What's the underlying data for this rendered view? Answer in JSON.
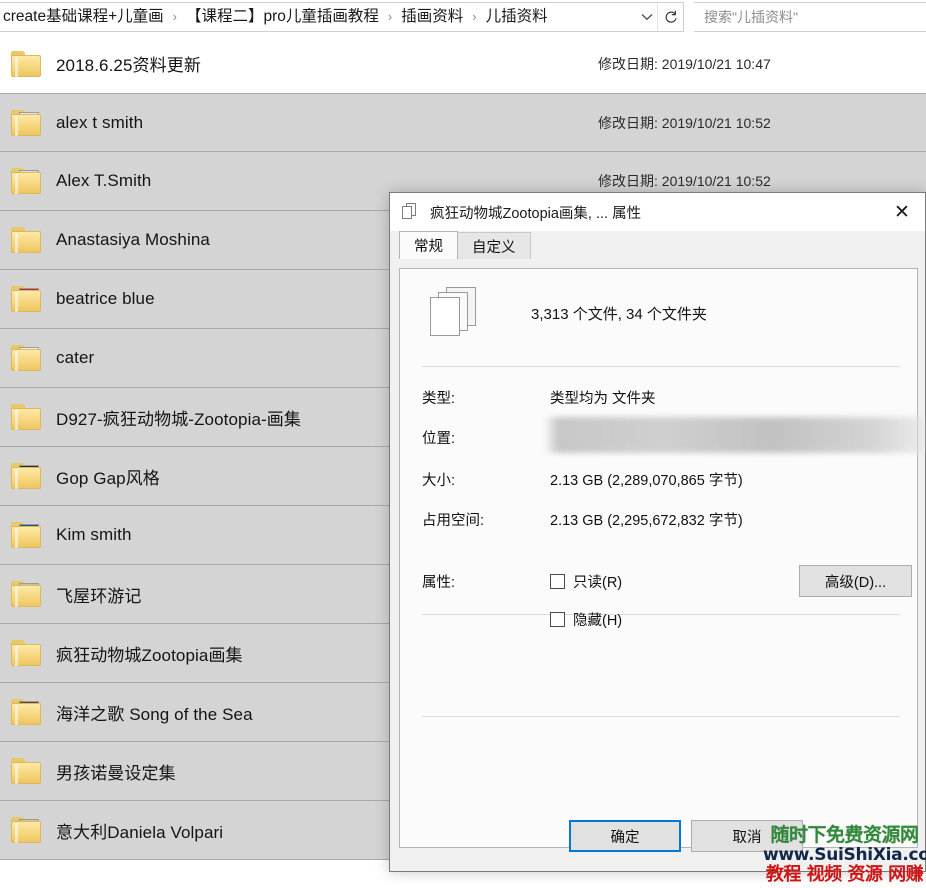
{
  "addressbar": {
    "breadcrumbs": [
      "create基础课程+儿童画",
      "【课程二】pro儿童插画教程",
      "插画资料",
      "儿插资料"
    ],
    "separator": "›",
    "dropdown_icon": "chevron-down-icon",
    "refresh_icon": "refresh-icon",
    "refresh_glyph": "↻"
  },
  "search": {
    "placeholder": "搜索\"儿插资料\""
  },
  "filelist": {
    "date_label": "修改日期:",
    "rows": [
      {
        "name": "2018.6.25资料更新",
        "date": "修改日期: 2019/10/21 10:47",
        "selected": false,
        "thumb": "plain"
      },
      {
        "name": "alex t smith",
        "date": "修改日期: 2019/10/21 10:52",
        "selected": true,
        "thumb": "sketch"
      },
      {
        "name": "Alex T.Smith",
        "date": "修改日期: 2019/10/21 10:52",
        "selected": true,
        "thumb": "figure"
      },
      {
        "name": "Anastasiya Moshina",
        "date": "",
        "selected": true,
        "thumb": "plain"
      },
      {
        "name": "beatrice blue",
        "date": "",
        "selected": true,
        "thumb": "red"
      },
      {
        "name": "cater",
        "date": "",
        "selected": true,
        "thumb": "light"
      },
      {
        "name": "D927-疯狂动物城-Zootopia-画集",
        "date": "",
        "selected": true,
        "thumb": "plain"
      },
      {
        "name": "Gop Gap风格",
        "date": "",
        "selected": true,
        "thumb": "teal"
      },
      {
        "name": "Kim smith",
        "date": "",
        "selected": true,
        "thumb": "blue"
      },
      {
        "name": "飞屋环游记",
        "date": "",
        "selected": true,
        "thumb": "photo"
      },
      {
        "name": "疯狂动物城Zootopia画集",
        "date": "",
        "selected": true,
        "thumb": "plain"
      },
      {
        "name": "海洋之歌 Song of the Sea",
        "date": "",
        "selected": true,
        "thumb": "dark"
      },
      {
        "name": "男孩诺曼设定集",
        "date": "",
        "selected": true,
        "thumb": "plain"
      },
      {
        "name": "意大利Daniela Volpari",
        "date": "",
        "selected": true,
        "thumb": "photo"
      }
    ]
  },
  "dialog": {
    "title": "疯狂动物城Zootopia画集, ... 属性",
    "title_icon": "multiple-files-icon",
    "close_label": "✕",
    "tabs": [
      {
        "label": "常规",
        "active": true
      },
      {
        "label": "自定义",
        "active": false
      }
    ],
    "summary_icon": "stacked-documents-icon",
    "summary": "3,313 个文件,  34 个文件夹",
    "fields": {
      "type_label": "类型:",
      "type_value": "类型均为 文件夹",
      "location_label": "位置:",
      "location_value": "",
      "size_label": "大小:",
      "size_value": "2.13 GB (2,289,070,865 字节)",
      "used_label": "占用空间:",
      "used_value": "2.13 GB (2,295,672,832 字节)",
      "attributes_label": "属性:"
    },
    "checkboxes": [
      {
        "label": "只读(R)",
        "checked": false
      },
      {
        "label": "隐藏(H)",
        "checked": false
      }
    ],
    "advanced_button": "高级(D)...",
    "ok_button": "确定",
    "cancel_button": "取消"
  },
  "watermark": {
    "line1": "随时下免费资源网",
    "line2": "www.SuiShiXia.com",
    "line3": "教程 视频 资源 网赚",
    "color1": "#2f8a3a",
    "color2": "#12284b",
    "color3": "#d01414"
  }
}
